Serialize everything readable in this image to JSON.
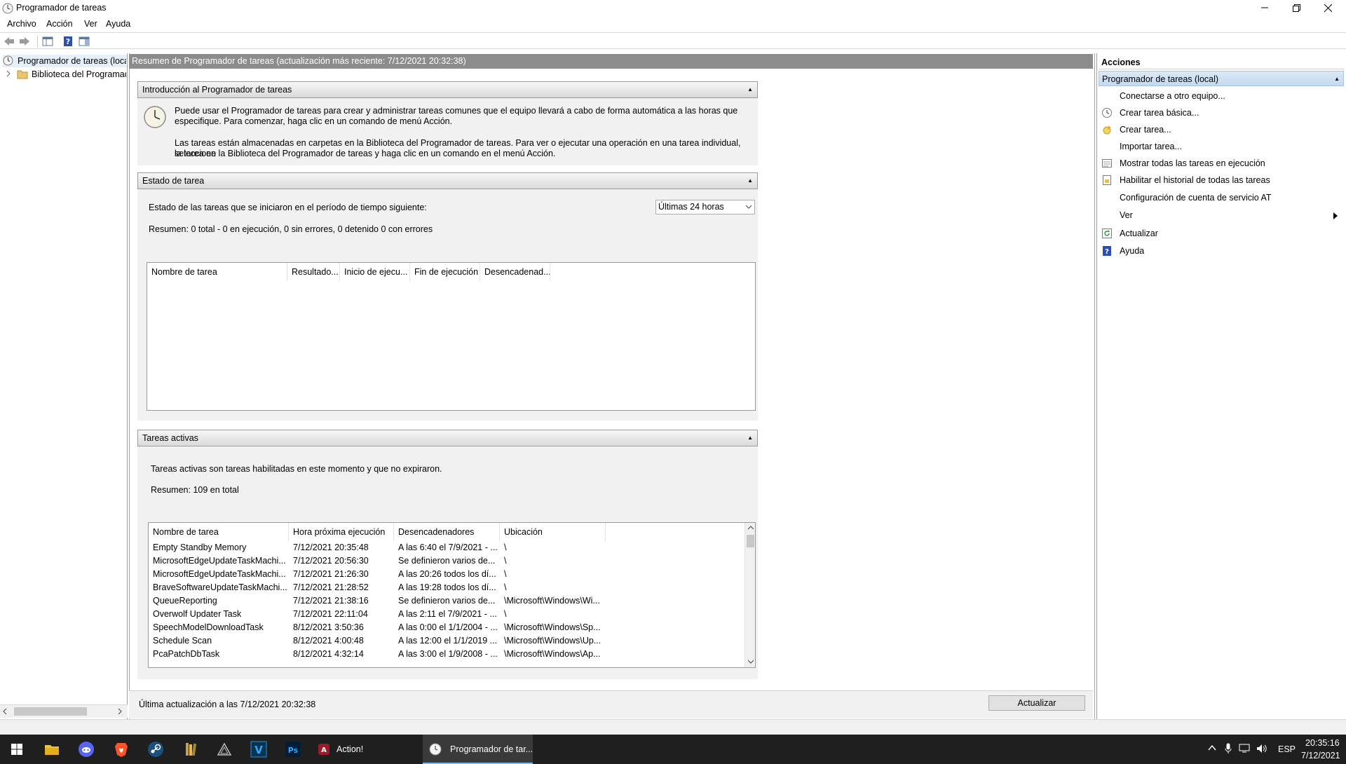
{
  "window": {
    "title": "Programador de tareas"
  },
  "menu": [
    "Archivo",
    "Acción",
    "Ver",
    "Ayuda"
  ],
  "tree": {
    "root": "Programador de tareas (local)",
    "library": "Biblioteca del Programador de tareas"
  },
  "center": {
    "header": "Resumen de Programador de tareas (actualización más reciente: 7/12/2021 20:32:38)",
    "intro": {
      "title": "Introducción al Programador de tareas",
      "p1_line1": "Puede usar el Programador de tareas para crear y administrar tareas comunes que el equipo llevará a cabo de forma automática a las horas que",
      "p1_line2": "especifique. Para comenzar, haga clic en un comando de menú Acción.",
      "p2_line1": "Las tareas están almacenadas en carpetas en la Biblioteca del Programador de tareas. Para ver o ejecutar una operación en una tarea individual, seleccione",
      "p2_line2": "la tarea en la Biblioteca del Programador de tareas y haga clic en un comando en el menú Acción."
    },
    "status": {
      "title": "Estado de tarea",
      "period_label": "Estado de las tareas que se iniciaron en el período de tiempo siguiente:",
      "period_value": "Últimas 24 horas",
      "summary": "Resumen: 0 total - 0 en ejecución, 0 sin errores, 0 detenido  0 con errores",
      "columns": [
        "Nombre de tarea",
        "Resultado...",
        "Inicio de ejecu...",
        "Fin de ejecución",
        "Desencadenad..."
      ]
    },
    "active": {
      "title": "Tareas activas",
      "description": "Tareas activas son tareas habilitadas en este momento y que no expiraron.",
      "summary": "Resumen: 109 en total",
      "columns": [
        "Nombre de tarea",
        "Hora próxima ejecución",
        "Desencadenadores",
        "Ubicación"
      ],
      "rows": [
        [
          "Empty Standby Memory",
          "7/12/2021 20:35:48",
          "A las 6:40 el 7/9/2021 - ...",
          "\\"
        ],
        [
          "MicrosoftEdgeUpdateTaskMachi...",
          "7/12/2021 20:56:30",
          "Se definieron varios de...",
          "\\"
        ],
        [
          "MicrosoftEdgeUpdateTaskMachi...",
          "7/12/2021 21:26:30",
          "A las 20:26 todos los dí...",
          "\\"
        ],
        [
          "BraveSoftwareUpdateTaskMachi...",
          "7/12/2021 21:28:52",
          "A las 19:28 todos los dí...",
          "\\"
        ],
        [
          "QueueReporting",
          "7/12/2021 21:38:16",
          "Se definieron varios de...",
          "\\Microsoft\\Windows\\Wi..."
        ],
        [
          "Overwolf Updater Task",
          "7/12/2021 22:11:04",
          "A las 2:11 el 7/9/2021 - ...",
          "\\"
        ],
        [
          "SpeechModelDownloadTask",
          "8/12/2021 3:50:36",
          "A las 0:00 el 1/1/2004 - ...",
          "\\Microsoft\\Windows\\Sp..."
        ],
        [
          "Schedule Scan",
          "8/12/2021 4:00:48",
          "A las 12:00 el 1/1/2019 ...",
          "\\Microsoft\\Windows\\Up..."
        ],
        [
          "PcaPatchDbTask",
          "8/12/2021 4:32:14",
          "A las 3:00 el 1/9/2008 - ...",
          "\\Microsoft\\Windows\\Ap..."
        ]
      ]
    },
    "footer": {
      "last_update": "Última actualización a las 7/12/2021 20:32:38",
      "refresh_button": "Actualizar"
    }
  },
  "actions": {
    "title": "Acciones",
    "group": "Programador de tareas (local)",
    "items": [
      {
        "label": "Conectarse a otro equipo...",
        "icon": "none"
      },
      {
        "label": "Crear tarea básica...",
        "icon": "clock-wizard-icon"
      },
      {
        "label": "Crear tarea...",
        "icon": "new-task-icon"
      },
      {
        "label": "Importar tarea...",
        "icon": "none"
      },
      {
        "label": "Mostrar todas las tareas en ejecución",
        "icon": "running-tasks-icon"
      },
      {
        "label": "Habilitar el historial de todas las tareas",
        "icon": "history-icon"
      },
      {
        "label": "Configuración de cuenta de servicio AT",
        "icon": "none"
      },
      {
        "label": "Ver",
        "icon": "submenu-arrow-icon"
      },
      {
        "label": "Actualizar",
        "icon": "refresh-icon"
      },
      {
        "label": "Ayuda",
        "icon": "help-icon"
      }
    ]
  },
  "taskbar": {
    "apps": [
      "windows-start-icon",
      "file-explorer-icon",
      "discord-icon",
      "brave-icon",
      "steam-icon",
      "library-icon",
      "triangle-app-icon",
      "v-app-icon",
      "photoshop-icon"
    ],
    "action_label": "Action!",
    "scheduler_label": "Programador de tar...",
    "tray_lang": "ESP",
    "time": "20:35:16",
    "date": "7/12/2021"
  },
  "colors": {
    "header_gray": "#8c8c8c",
    "section_bg": "#f1f1f1",
    "action_group_blue": "#c3d9f0",
    "taskbar": "#1f1f1f",
    "help_icon_blue": "#2a4fb0"
  }
}
